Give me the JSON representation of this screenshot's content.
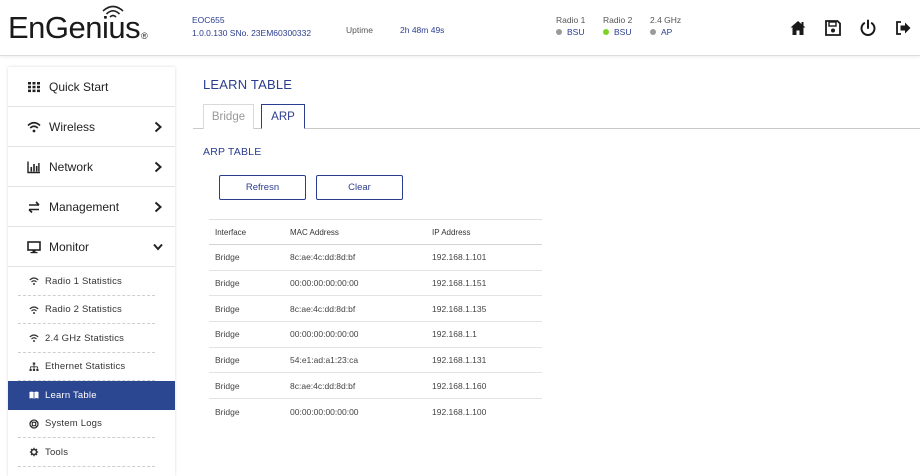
{
  "header": {
    "logo_text": "EnGenius",
    "logo_reg": "®",
    "device_name": "EOC655",
    "device_info": "1.0.0.130 SNo. 23EM60300332",
    "uptime_label": "Uptime",
    "uptime_value": "2h 48m 49s",
    "radios": [
      {
        "title": "Radio 1",
        "status": "BSU",
        "dot_color": "#9a9a9a"
      },
      {
        "title": "Radio 2",
        "status": "BSU",
        "dot_color": "#7ed321"
      },
      {
        "title": "2.4 GHz",
        "status": "AP",
        "dot_color": "#9a9a9a"
      }
    ],
    "icons": [
      "home-icon",
      "save-icon",
      "power-icon",
      "logout-icon"
    ]
  },
  "sidebar": {
    "items": [
      {
        "label": "Quick Start",
        "icon": "grid-icon"
      },
      {
        "label": "Wireless",
        "icon": "wifi-icon"
      },
      {
        "label": "Network",
        "icon": "bar-chart-icon"
      },
      {
        "label": "Management",
        "icon": "exchange-icon"
      },
      {
        "label": "Monitor",
        "icon": "monitor-icon"
      }
    ],
    "sub_items": [
      {
        "label": "Radio 1 Statistics",
        "icon": "wifi-icon"
      },
      {
        "label": "Radio 2 Statistics",
        "icon": "wifi-icon"
      },
      {
        "label": "2.4 GHz Statistics",
        "icon": "wifi-icon"
      },
      {
        "label": "Ethernet Statistics",
        "icon": "sitemap-icon"
      },
      {
        "label": "Learn Table",
        "icon": "book-icon",
        "active": true
      },
      {
        "label": "System Logs",
        "icon": "life-ring-icon"
      },
      {
        "label": "Tools",
        "icon": "gear-icon"
      }
    ]
  },
  "main": {
    "title": "LEARN TABLE",
    "tabs": [
      {
        "label": "Bridge",
        "active": false
      },
      {
        "label": "ARP",
        "active": true
      }
    ],
    "section_title": "ARP TABLE",
    "buttons": {
      "refresh": "Refresn",
      "clear": "Clear"
    },
    "table": {
      "columns": [
        "Interface",
        "MAC Address",
        "IP Address"
      ],
      "rows": [
        [
          "Bridge",
          "8c:ae:4c:dd:8d:bf",
          "192.168.1.101"
        ],
        [
          "Bridge",
          "00:00:00:00:00:00",
          "192.168.1.151"
        ],
        [
          "Bridge",
          "8c:ae:4c:dd:8d:bf",
          "192.168.1.135"
        ],
        [
          "Bridge",
          "00:00:00:00:00:00",
          "192.168.1.1"
        ],
        [
          "Bridge",
          "54:e1:ad:a1:23:ca",
          "192.168.1.131"
        ],
        [
          "Bridge",
          "8c:ae:4c:dd:8d:bf",
          "192.168.1.160"
        ],
        [
          "Bridge",
          "00:00:00:00:00:00",
          "192.168.1.100"
        ]
      ]
    }
  },
  "colors": {
    "accent": "#2b3d8f",
    "active_bg": "#2c4791"
  }
}
